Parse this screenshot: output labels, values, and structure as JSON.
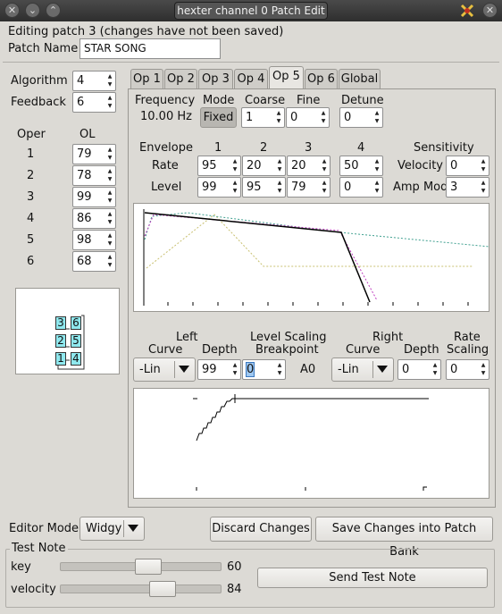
{
  "window": {
    "title": "hexter channel 0 Patch Edit"
  },
  "status_text": "Editing patch 3 (changes have not been saved)",
  "patch_name": {
    "label": "Patch Name",
    "value": "STAR SONG"
  },
  "algorithm": {
    "label": "Algorithm",
    "value": "4"
  },
  "feedback": {
    "label": "Feedback",
    "value": "6"
  },
  "oper": {
    "header": "Oper",
    "ol_header": "OL",
    "rows": [
      {
        "n": "1",
        "ol": "79"
      },
      {
        "n": "2",
        "ol": "78"
      },
      {
        "n": "3",
        "ol": "99"
      },
      {
        "n": "4",
        "ol": "86"
      },
      {
        "n": "5",
        "ol": "98"
      },
      {
        "n": "6",
        "ol": "68"
      }
    ]
  },
  "algo_boxes": [
    "3",
    "6",
    "2",
    "5",
    "1",
    "4"
  ],
  "tabs": [
    "Op 1",
    "Op 2",
    "Op 3",
    "Op 4",
    "Op 5",
    "Op 6",
    "Global"
  ],
  "active_tab": "Op 5",
  "freq": {
    "label": "Frequency",
    "value": "10.00 Hz"
  },
  "mode": {
    "label": "Mode",
    "value": "Fixed"
  },
  "coarse": {
    "label": "Coarse",
    "value": "1"
  },
  "fine": {
    "label": "Fine",
    "value": "0"
  },
  "detune": {
    "label": "Detune",
    "value": "0"
  },
  "envelope": {
    "label": "Envelope",
    "rate_label": "Rate",
    "level_label": "Level",
    "cols": [
      "1",
      "2",
      "3",
      "4"
    ],
    "rate": [
      "95",
      "20",
      "20",
      "50"
    ],
    "level": [
      "99",
      "95",
      "79",
      "0"
    ]
  },
  "sensitivity": {
    "label": "Sensitivity",
    "velocity_label": "Velocity",
    "velocity": "0",
    "ampmod_label": "Amp Mod",
    "ampmod": "3"
  },
  "scaling": {
    "left_label": "Left",
    "curve_label": "Curve",
    "depth_label": "Depth",
    "level_scaling_label": "Level Scaling",
    "breakpoint_label": "Breakpoint",
    "right_label": "Right",
    "rate_label": "Rate",
    "scaling_label": "Scaling",
    "left_curve": "-Lin",
    "left_depth": "99",
    "breakpoint": "0",
    "breakpoint_note": "A0",
    "right_curve": "-Lin",
    "right_depth": "0",
    "rate_scaling": "0"
  },
  "editor_mode": {
    "label": "Editor Mode",
    "value": "Widgy"
  },
  "discard_label": "Discard Changes",
  "save_label": "Save Changes into Patch Bank",
  "test_note": {
    "label": "Test Note",
    "key_label": "key",
    "key_value": "60",
    "key_fraction": 0.6,
    "velocity_label": "velocity",
    "velocity_value": "84",
    "velocity_fraction": 0.75,
    "send_label": "Send Test Note"
  }
}
